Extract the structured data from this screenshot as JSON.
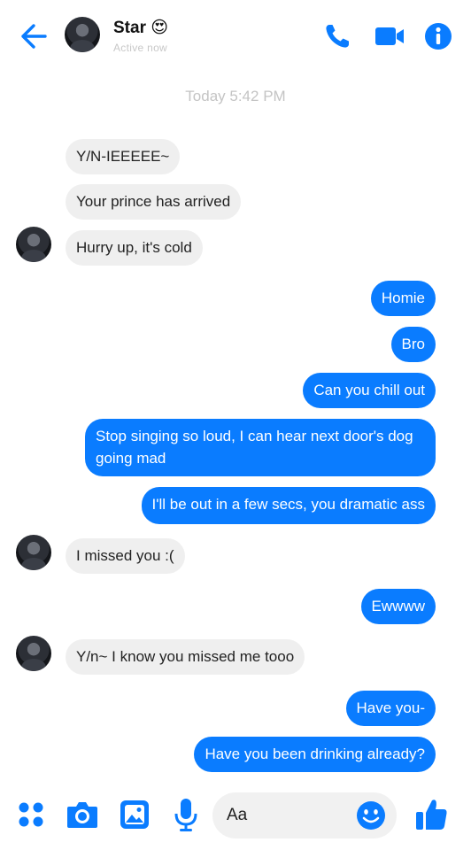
{
  "header": {
    "contact_name": "Star 😍",
    "status": "Active now",
    "icons": [
      "back-arrow-icon",
      "phone-icon",
      "video-camera-icon",
      "info-icon"
    ]
  },
  "thread": {
    "timestamp": "Today 5:42 PM",
    "messages": [
      {
        "from": "them",
        "text": "Y/N-IEEEEE~"
      },
      {
        "from": "them",
        "text": "Your prince has arrived"
      },
      {
        "from": "them",
        "text": "Hurry up, it's cold"
      },
      {
        "from": "me",
        "text": "Homie"
      },
      {
        "from": "me",
        "text": "Bro"
      },
      {
        "from": "me",
        "text": "Can you chill out"
      },
      {
        "from": "me",
        "text": "Stop singing so loud, I can hear next door's dog going mad"
      },
      {
        "from": "me",
        "text": "I'll be out in a few secs, you dramatic ass"
      },
      {
        "from": "them",
        "text": "I missed you :("
      },
      {
        "from": "me",
        "text": "Ewwww"
      },
      {
        "from": "them",
        "text": "Y/n~ I know you missed me tooo"
      },
      {
        "from": "me",
        "text": "Have you-"
      },
      {
        "from": "me",
        "text": "Have you been drinking already?"
      }
    ]
  },
  "composer": {
    "placeholder": "Aa",
    "icons": [
      "menu-dots-icon",
      "camera-icon",
      "gallery-icon",
      "microphone-icon",
      "emoji-icon",
      "thumbs-up-icon"
    ]
  },
  "colors": {
    "accent": "#0a7cff",
    "received_bubble": "#efefef",
    "muted_text": "#c4c4c4"
  }
}
